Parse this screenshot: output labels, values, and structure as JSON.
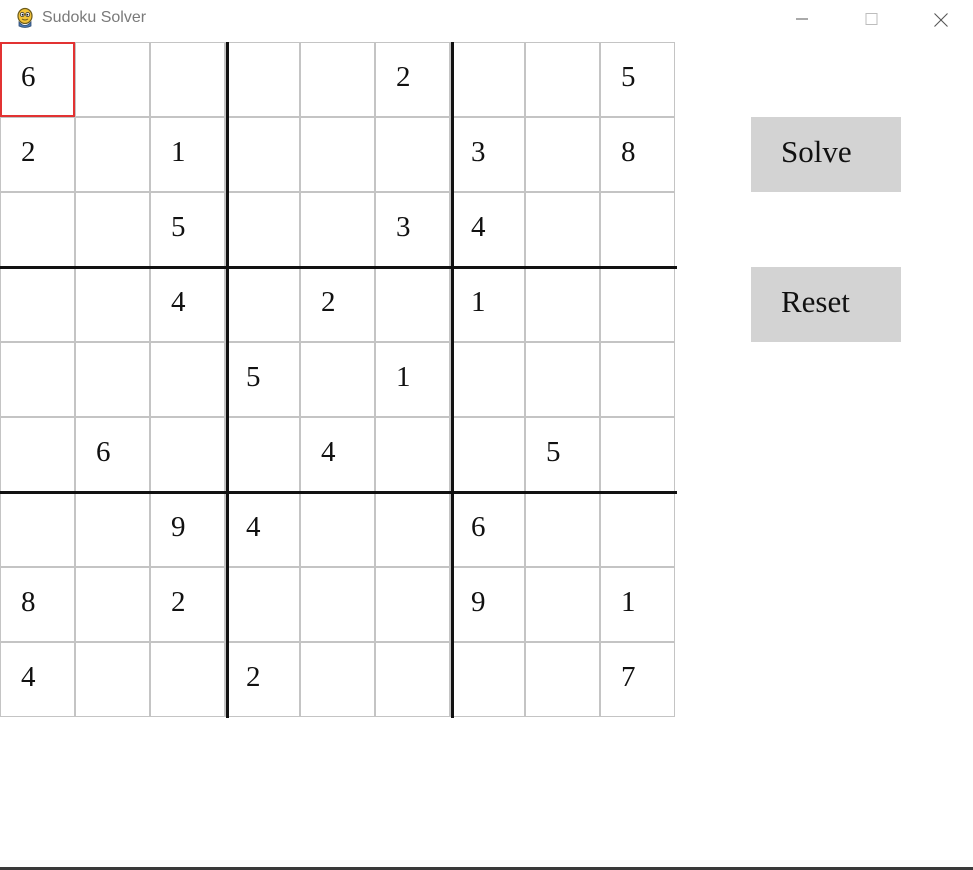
{
  "window": {
    "title": "Sudoku Solver",
    "icon": "python-snake-icon"
  },
  "board": {
    "selected": [
      0,
      0
    ],
    "rows": [
      [
        "6",
        "",
        "",
        "",
        "",
        "2",
        "",
        "",
        "5"
      ],
      [
        "2",
        "",
        "1",
        "",
        "",
        "",
        "3",
        "",
        "8"
      ],
      [
        "",
        "",
        "5",
        "",
        "",
        "3",
        "4",
        "",
        ""
      ],
      [
        "",
        "",
        "4",
        "",
        "2",
        "",
        "1",
        "",
        ""
      ],
      [
        "",
        "",
        "",
        "5",
        "",
        "1",
        "",
        "",
        ""
      ],
      [
        "",
        "6",
        "",
        "",
        "4",
        "",
        "",
        "5",
        ""
      ],
      [
        "",
        "",
        "9",
        "4",
        "",
        "",
        "6",
        "",
        ""
      ],
      [
        "8",
        "",
        "2",
        "",
        "",
        "",
        "9",
        "",
        "1"
      ],
      [
        "4",
        "",
        "",
        "2",
        "",
        "",
        "",
        "",
        "7"
      ]
    ]
  },
  "controls": {
    "solve_label": "Solve",
    "reset_label": "Reset"
  },
  "colors": {
    "selected_border": "#e23232",
    "button_background": "#d3d3d3",
    "grid_line": "#c4c4c4",
    "box_line": "#111111"
  }
}
